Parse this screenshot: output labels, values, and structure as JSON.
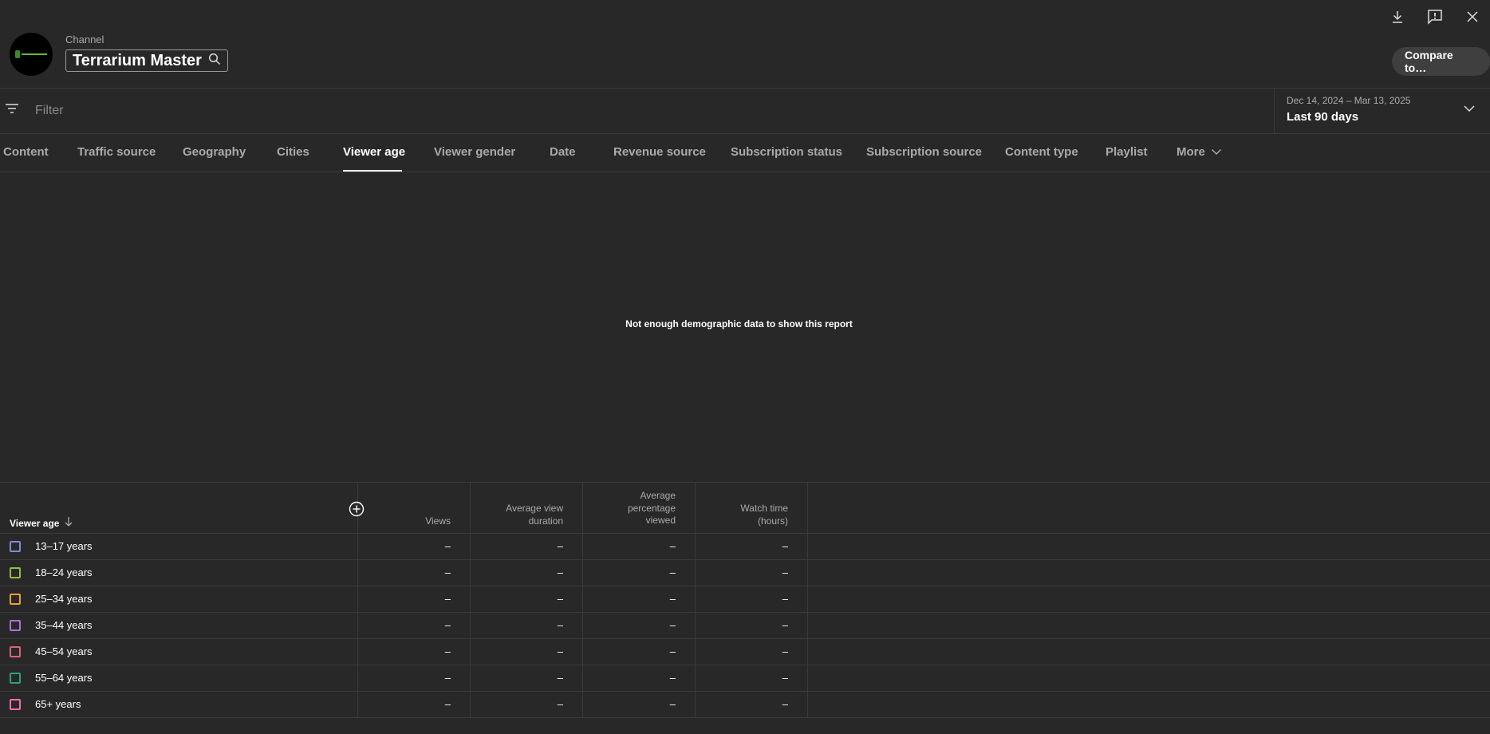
{
  "header": {
    "channel_label": "Channel",
    "channel_name": "Terrarium Master",
    "compare_label": "Compare to…"
  },
  "filter": {
    "placeholder": "Filter",
    "date_range": "Dec 14, 2024 – Mar 13, 2025",
    "date_preset": "Last 90 days"
  },
  "tabs": [
    {
      "label": "Content"
    },
    {
      "label": "Traffic source"
    },
    {
      "label": "Geography"
    },
    {
      "label": "Cities"
    },
    {
      "label": "Viewer age"
    },
    {
      "label": "Viewer gender"
    },
    {
      "label": "Date"
    },
    {
      "label": "Revenue source"
    },
    {
      "label": "Subscription status"
    },
    {
      "label": "Subscription source"
    },
    {
      "label": "Content type"
    },
    {
      "label": "Playlist"
    },
    {
      "label": "More"
    }
  ],
  "active_tab": "Viewer age",
  "message": "Not enough demographic data to show this report",
  "table": {
    "headers": {
      "dimension": "Viewer age",
      "views": "Views",
      "avg_view_duration_l1": "Average view",
      "avg_view_duration_l2": "duration",
      "avg_pct_l1": "Average",
      "avg_pct_l2": "percentage",
      "avg_pct_l3": "viewed",
      "watch_time_l1": "Watch time",
      "watch_time_l2": "(hours)"
    },
    "rows": [
      {
        "label": "13–17 years",
        "color": "#7e8cd8",
        "views": "–",
        "avg_view_duration": "–",
        "avg_pct": "–",
        "watch_time": "–"
      },
      {
        "label": "18–24 years",
        "color": "#8fbf3f",
        "views": "–",
        "avg_view_duration": "–",
        "avg_pct": "–",
        "watch_time": "–"
      },
      {
        "label": "25–34 years",
        "color": "#f0a030",
        "views": "–",
        "avg_view_duration": "–",
        "avg_pct": "–",
        "watch_time": "–"
      },
      {
        "label": "35–44 years",
        "color": "#b070d8",
        "views": "–",
        "avg_view_duration": "–",
        "avg_pct": "–",
        "watch_time": "–"
      },
      {
        "label": "45–54 years",
        "color": "#e0607a",
        "views": "–",
        "avg_view_duration": "–",
        "avg_pct": "–",
        "watch_time": "–"
      },
      {
        "label": "55–64 years",
        "color": "#2fa078",
        "views": "–",
        "avg_view_duration": "–",
        "avg_pct": "–",
        "watch_time": "–"
      },
      {
        "label": "65+ years",
        "color": "#f070b0",
        "views": "–",
        "avg_view_duration": "–",
        "avg_pct": "–",
        "watch_time": "–"
      }
    ]
  }
}
